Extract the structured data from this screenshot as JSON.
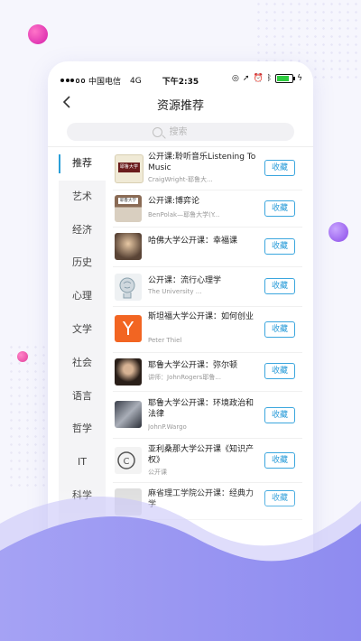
{
  "status_bar": {
    "carrier": "中国电信",
    "network": "4G",
    "time": "下午2:35"
  },
  "nav": {
    "back_icon": "chevron-left-icon",
    "title": "资源推荐"
  },
  "search": {
    "placeholder": "搜索",
    "icon": "search-icon"
  },
  "categories": [
    "推荐",
    "艺术",
    "经济",
    "历史",
    "心理",
    "文学",
    "社会",
    "语言",
    "哲学",
    "IT",
    "科学"
  ],
  "active_category": "推荐",
  "items": [
    {
      "title": "公开课:聆听音乐Listening To Music",
      "subtitle": "CraigWright-耶鲁大...",
      "action": "收藏"
    },
    {
      "title": "公开课:博弈论",
      "subtitle": "BenPolak—耶鲁大学(Y...",
      "action": "收藏"
    },
    {
      "title": "哈佛大学公开课：幸福课",
      "subtitle": "",
      "action": "收藏"
    },
    {
      "title": "公开课：流行心理学",
      "subtitle": "The University ...",
      "action": "收藏"
    },
    {
      "title": "斯坦福大学公开课：如何创业",
      "subtitle": "Peter Thiel",
      "action": "收藏"
    },
    {
      "title": "耶鲁大学公开课：弥尔顿",
      "subtitle": "讲师：JohnRogers耶鲁...",
      "action": "收藏"
    },
    {
      "title": "耶鲁大学公开课：环境政治和法律",
      "subtitle": "JohnP.Wargo",
      "action": "收藏"
    },
    {
      "title": "亚利桑那大学公开课《知识产权》",
      "subtitle": "公开课",
      "action": "收藏"
    },
    {
      "title": "麻省理工学院公开课：经典力学",
      "subtitle": "",
      "action": "收藏"
    }
  ],
  "thumb_labels": {
    "yale": "耶鲁大学",
    "y_logo": "Y"
  },
  "colors": {
    "accent": "#2a9cd9",
    "background": "#f6f6fd",
    "wave": "#9a97f2"
  }
}
